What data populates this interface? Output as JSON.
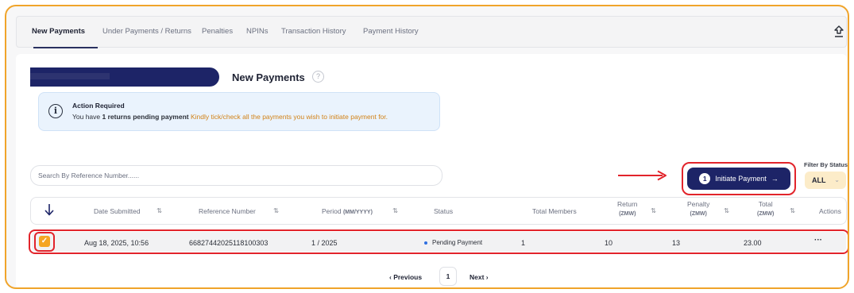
{
  "tabs": [
    {
      "label": "New Payments",
      "active": true
    },
    {
      "label": "Under Payments / Returns"
    },
    {
      "label": "Penalties"
    },
    {
      "label": "NPINs"
    },
    {
      "label": "Transaction History"
    },
    {
      "label": "Payment History"
    }
  ],
  "page": {
    "title": "New Payments",
    "help_icon": "?"
  },
  "alert": {
    "icon": "i",
    "title": "Action Required",
    "msg_prefix": "You have ",
    "msg_bold": "1 returns pending payment",
    "msg_suffix": " Kindly tick/check all the payments you wish to initiate payment for."
  },
  "search": {
    "placeholder": "Search By Reference Number......"
  },
  "initiate": {
    "count": "1",
    "label": "Initiate Payment",
    "arrow": "→"
  },
  "filter": {
    "label": "Filter By Status",
    "value": "ALL",
    "chevron": "⌄"
  },
  "table": {
    "headers": {
      "date": "Date Submitted",
      "reference": "Reference Number",
      "period": "Period",
      "period_unit": "(MM/YYYY)",
      "status": "Status",
      "members": "Total Members",
      "return": "Return",
      "return_unit": "(ZMW)",
      "penalty": "Penalty",
      "penalty_unit": "(ZMW)",
      "total": "Total",
      "total_unit": "(ZMW)",
      "actions": "Actions"
    },
    "sort_glyph": "⇅",
    "rows": [
      {
        "checked": true,
        "check_glyph": "✓",
        "date": "Aug 18, 2025, 10:56",
        "reference": "66827442025118100303",
        "period": "1 / 2025",
        "status": "Pending Payment",
        "members": "1",
        "return": "10",
        "penalty": "13",
        "total": "23.00",
        "actions": "···"
      }
    ]
  },
  "pagination": {
    "prev": "‹  Previous",
    "page": "1",
    "next": "Next  ›"
  },
  "colors": {
    "frame_border": "#f0a42a",
    "annotation_red": "#e2242b",
    "primary_navy": "#1d2467",
    "checkbox_orange": "#f5a623",
    "alert_bg": "#eaf3fd",
    "filter_bg": "#fcecc9"
  }
}
